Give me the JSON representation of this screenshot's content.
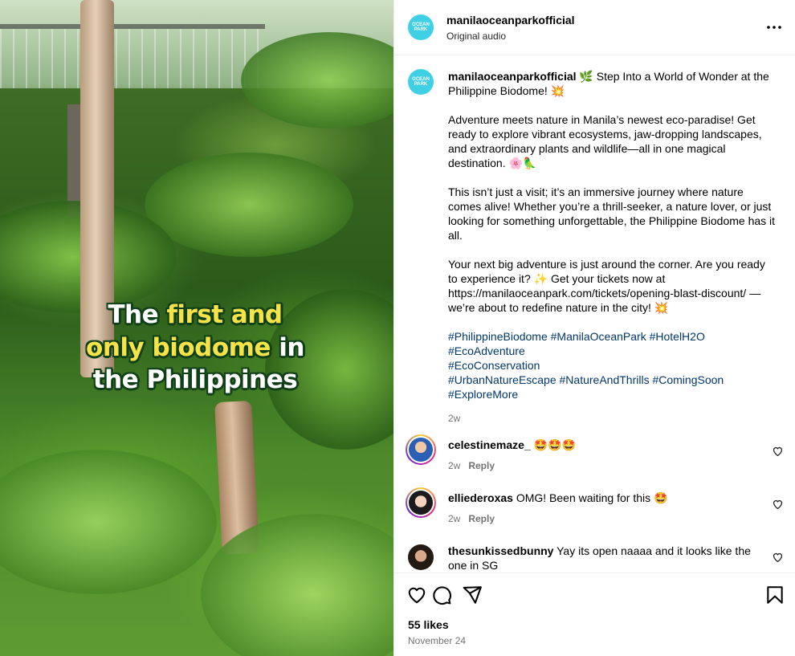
{
  "media": {
    "overlay_lines": [
      {
        "plain_before": "The ",
        "highlight": "first and",
        "plain_after": ""
      },
      {
        "plain_before": "",
        "highlight": "only biodome",
        "plain_after": " in"
      },
      {
        "plain_before": "the Philippines",
        "highlight": "",
        "plain_after": ""
      }
    ],
    "colors": {
      "highlight": "#f6e34a",
      "outline": "#114018"
    }
  },
  "header": {
    "username": "manilaoceanparkofficial",
    "audio": "Original audio",
    "avatar_icon": "ocean-park-logo-icon",
    "more_icon": "more-horizontal-icon"
  },
  "caption": {
    "username": "manilaoceanparkofficial",
    "intro": "🌿 Step Into a World of Wonder at the Philippine Biodome! 💥",
    "p1": "Adventure meets nature in Manila’s newest eco-paradise! Get ready to explore vibrant ecosystems, jaw-dropping landscapes, and extraordinary plants and wildlife—all in one magical destination. 🌸🦜",
    "p2": "This isn’t just a visit; it’s an immersive journey where nature comes alive! Whether you’re a thrill-seeker, a nature lover, or just looking for something unforgettable, the Philippine Biodome has it all.",
    "p3": "Your next big adventure is just around the corner. Are you ready to experience it? ✨ Get your tickets now at https://manilaoceanpark.com/tickets/opening-blast-discount/ — we’re about to redefine nature in the city! 💥",
    "hashtags": [
      "#PhilippineBiodome #ManilaOceanPark #HotelH2O",
      "#EcoAdventure",
      "#EcoConservation",
      "#UrbanNatureEscape #NatureAndThrills #ComingSoon",
      "#ExploreMore"
    ],
    "time": "2w"
  },
  "comments": [
    {
      "username": "celestinemaze_",
      "text": "🤩🤩🤩",
      "time": "2w",
      "reply": "Reply",
      "story_ring": true
    },
    {
      "username": "elliederoxas",
      "text": "OMG! Been waiting for this 🤩",
      "time": "2w",
      "reply": "Reply",
      "story_ring": true
    },
    {
      "username": "thesunkissedbunny",
      "text": "Yay its open naaaa and it looks like the one in SG",
      "time": "",
      "reply": "",
      "story_ring": false
    }
  ],
  "actions": {
    "icons": [
      "heart-icon",
      "comment-icon",
      "share-icon",
      "bookmark-icon"
    ],
    "likes": "55 likes",
    "date": "November 24"
  },
  "colors": {
    "link": "#00376b",
    "muted": "#737373",
    "brand_avatar": "#3fd0e6"
  }
}
